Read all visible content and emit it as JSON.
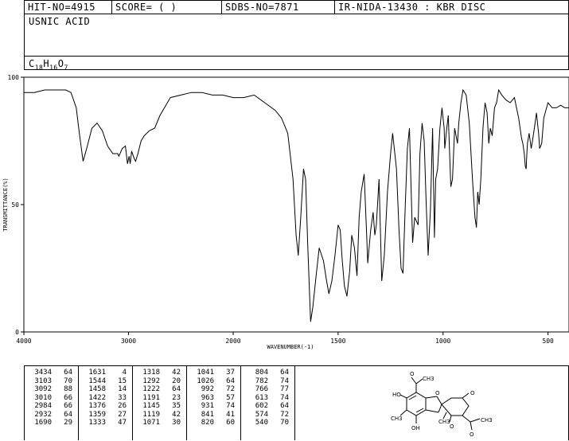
{
  "header": {
    "hit_no": "HIT-NO=4915",
    "score": "SCORE=  (  )",
    "sdbs_no": "SDBS-NO=7871",
    "ir_info": "IR-NIDA-13430 : KBR DISC"
  },
  "compound": {
    "name": "USNIC ACID",
    "formula_parts": [
      "C",
      "18",
      "H",
      "16",
      "O",
      "7"
    ]
  },
  "chart_data": {
    "type": "line",
    "xlabel": "WAVENUMBER(-1)",
    "ylabel": "TRANSMITTANCE(%)",
    "xlim": [
      4000,
      400
    ],
    "ylim": [
      0,
      100
    ],
    "x_ticks": [
      "4000",
      "3000",
      "2000",
      "1500",
      "1000",
      "500"
    ],
    "y_ticks": [
      "100",
      "50",
      "0"
    ],
    "series": [
      {
        "x": [
          4000,
          3900,
          3800,
          3700,
          3600,
          3550,
          3500,
          3470,
          3434,
          3400,
          3350,
          3300,
          3250,
          3200,
          3150,
          3103,
          3092,
          3060,
          3030,
          3010,
          2995,
          2984,
          2970,
          2945,
          2932,
          2910,
          2880,
          2850,
          2800,
          2750,
          2700,
          2600,
          2500,
          2400,
          2300,
          2200,
          2100,
          2000,
          1950,
          1900,
          1850,
          1800,
          1770,
          1740,
          1715,
          1700,
          1690,
          1678,
          1665,
          1655,
          1645,
          1631,
          1620,
          1605,
          1590,
          1570,
          1555,
          1544,
          1530,
          1515,
          1500,
          1490,
          1480,
          1470,
          1458,
          1445,
          1435,
          1422,
          1410,
          1400,
          1390,
          1376,
          1365,
          1359,
          1345,
          1333,
          1325,
          1318,
          1305,
          1292,
          1280,
          1265,
          1250,
          1240,
          1222,
          1210,
          1200,
          1191,
          1180,
          1170,
          1160,
          1145,
          1135,
          1119,
          1110,
          1100,
          1090,
          1080,
          1071,
          1060,
          1050,
          1041,
          1035,
          1026,
          1015,
          1005,
          995,
          992,
          985,
          975,
          963,
          955,
          945,
          931,
          925,
          915,
          905,
          890,
          875,
          860,
          848,
          841,
          835,
          828,
          820,
          810,
          800,
          790,
          782,
          775,
          766,
          755,
          745,
          735,
          720,
          700,
          680,
          660,
          640,
          626,
          620,
          613,
          608,
          604,
          602,
          598,
          590,
          580,
          574,
          565,
          555,
          545,
          540,
          530,
          520,
          500,
          480,
          460,
          440,
          420,
          400
        ],
        "y": [
          94,
          94,
          95,
          95,
          95,
          94,
          88,
          78,
          67,
          72,
          80,
          82,
          79,
          73,
          70,
          70,
          69,
          72,
          73,
          66,
          69,
          66,
          71,
          68,
          67,
          70,
          75,
          77,
          79,
          80,
          85,
          92,
          93,
          94,
          94,
          93,
          93,
          92,
          92,
          93,
          90,
          87,
          84,
          78,
          60,
          38,
          30,
          45,
          64,
          60,
          35,
          4,
          10,
          22,
          33,
          28,
          20,
          15,
          20,
          30,
          42,
          40,
          28,
          18,
          14,
          24,
          38,
          33,
          22,
          45,
          55,
          62,
          40,
          27,
          40,
          47,
          38,
          42,
          60,
          20,
          30,
          55,
          70,
          78,
          64,
          40,
          25,
          23,
          50,
          72,
          80,
          35,
          45,
          42,
          70,
          82,
          75,
          50,
          30,
          48,
          80,
          37,
          60,
          64,
          80,
          88,
          80,
          72,
          78,
          85,
          57,
          60,
          80,
          74,
          82,
          90,
          95,
          93,
          82,
          60,
          45,
          41,
          55,
          50,
          60,
          80,
          90,
          86,
          74,
          80,
          77,
          88,
          90,
          95,
          93,
          91,
          90,
          92,
          84,
          76,
          74,
          70,
          65,
          64,
          68,
          74,
          78,
          72,
          75,
          80,
          86,
          78,
          72,
          74,
          84,
          90,
          88,
          88,
          89,
          88,
          88
        ]
      }
    ]
  },
  "peak_table": {
    "columns": [
      [
        [
          "3434",
          "64"
        ],
        [
          "3103",
          "70"
        ],
        [
          "3092",
          "88"
        ],
        [
          "3010",
          "66"
        ],
        [
          "2984",
          "66"
        ],
        [
          "2932",
          "64"
        ],
        [
          "1690",
          "29"
        ]
      ],
      [
        [
          "1631",
          "4"
        ],
        [
          "1544",
          "15"
        ],
        [
          "1458",
          "14"
        ],
        [
          "1422",
          "33"
        ],
        [
          "1376",
          "26"
        ],
        [
          "1359",
          "27"
        ],
        [
          "1333",
          "47"
        ]
      ],
      [
        [
          "1318",
          "42"
        ],
        [
          "1292",
          "20"
        ],
        [
          "1222",
          "64"
        ],
        [
          "1191",
          "23"
        ],
        [
          "1145",
          "35"
        ],
        [
          "1119",
          "42"
        ],
        [
          "1071",
          "30"
        ]
      ],
      [
        [
          "1041",
          "37"
        ],
        [
          "1026",
          "64"
        ],
        [
          "992",
          "72"
        ],
        [
          "963",
          "57"
        ],
        [
          "931",
          "74"
        ],
        [
          "841",
          "41"
        ],
        [
          "820",
          "60"
        ]
      ],
      [
        [
          "804",
          "64"
        ],
        [
          "782",
          "74"
        ],
        [
          "766",
          "77"
        ],
        [
          "613",
          "74"
        ],
        [
          "602",
          "64"
        ],
        [
          "574",
          "72"
        ],
        [
          "540",
          "70"
        ]
      ]
    ]
  },
  "structure_labels": {
    "o_top": "O",
    "ch3_top": "CH3",
    "oh_left": "HO",
    "o_right": "O",
    "ch3_left": "CH3",
    "o_ring": "O",
    "ch3_center": "CH3",
    "o_lower": "O",
    "oh_bottom": "OH",
    "ch3_right": "CH3",
    "o_right2": "O"
  }
}
